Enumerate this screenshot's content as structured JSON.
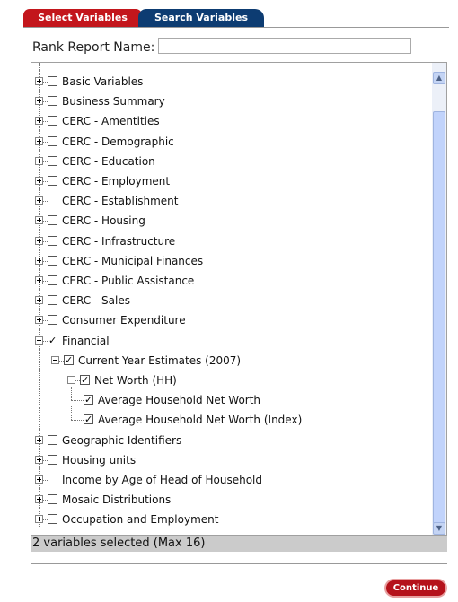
{
  "tabs": [
    {
      "label": "Select Variables"
    },
    {
      "label": "Search Variables"
    }
  ],
  "rank_report": {
    "label": "Rank Report Name:",
    "value": ""
  },
  "tree": [
    {
      "label": "Basic Variables",
      "level": 0,
      "expanded": false,
      "checked": false
    },
    {
      "label": "Business Summary",
      "level": 0,
      "expanded": false,
      "checked": false
    },
    {
      "label": "CERC - Amentities",
      "level": 0,
      "expanded": false,
      "checked": false
    },
    {
      "label": "CERC - Demographic",
      "level": 0,
      "expanded": false,
      "checked": false
    },
    {
      "label": "CERC - Education",
      "level": 0,
      "expanded": false,
      "checked": false
    },
    {
      "label": "CERC - Employment",
      "level": 0,
      "expanded": false,
      "checked": false
    },
    {
      "label": "CERC - Establishment",
      "level": 0,
      "expanded": false,
      "checked": false
    },
    {
      "label": "CERC - Housing",
      "level": 0,
      "expanded": false,
      "checked": false
    },
    {
      "label": "CERC - Infrastructure",
      "level": 0,
      "expanded": false,
      "checked": false
    },
    {
      "label": "CERC - Municipal Finances",
      "level": 0,
      "expanded": false,
      "checked": false
    },
    {
      "label": "CERC - Public Assistance",
      "level": 0,
      "expanded": false,
      "checked": false
    },
    {
      "label": "CERC - Sales",
      "level": 0,
      "expanded": false,
      "checked": false
    },
    {
      "label": "Consumer Expenditure",
      "level": 0,
      "expanded": false,
      "checked": false
    },
    {
      "label": "Financial",
      "level": 0,
      "expanded": true,
      "checked": true
    },
    {
      "label": "Current Year Estimates (2007)",
      "level": 1,
      "expanded": true,
      "checked": true
    },
    {
      "label": "Net Worth (HH)",
      "level": 2,
      "expanded": true,
      "checked": true
    },
    {
      "label": "Average Household Net Worth",
      "level": 3,
      "leaf": true,
      "checked": true
    },
    {
      "label": "Average Household Net Worth (Index)",
      "level": 3,
      "leaf": true,
      "checked": true
    },
    {
      "label": "Geographic Identifiers",
      "level": 0,
      "expanded": false,
      "checked": false
    },
    {
      "label": "Housing units",
      "level": 0,
      "expanded": false,
      "checked": false
    },
    {
      "label": "Income by Age of Head of Household",
      "level": 0,
      "expanded": false,
      "checked": false
    },
    {
      "label": "Mosaic Distributions",
      "level": 0,
      "expanded": false,
      "checked": false
    },
    {
      "label": "Occupation and Employment",
      "level": 0,
      "expanded": false,
      "checked": false
    }
  ],
  "status_text": "2 variables selected (Max 16)",
  "continue_label": "Continue",
  "colors": {
    "tab_active": "#c3161c",
    "tab_inactive": "#0d3c72",
    "status_bg": "#cbcbcb"
  }
}
